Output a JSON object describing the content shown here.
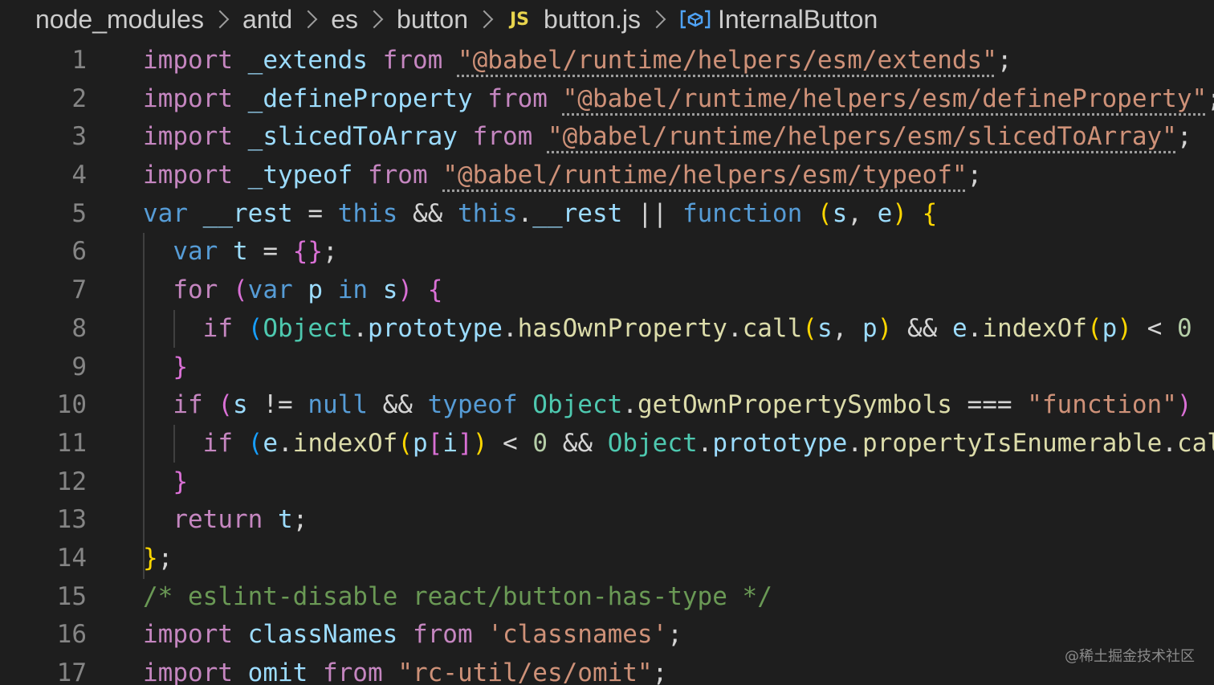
{
  "breadcrumb": {
    "items": [
      {
        "label": "node_modules"
      },
      {
        "label": "antd"
      },
      {
        "label": "es"
      },
      {
        "label": "button"
      },
      {
        "label": "button.js",
        "icon": "javascript-file-icon",
        "icon_text": "JS"
      },
      {
        "label": "InternalButton",
        "icon": "variable-symbol-icon"
      }
    ]
  },
  "colors": {
    "background": "#1e1e1e",
    "keyword_control": "#c586c0",
    "string": "#ce9178",
    "variable": "#9cdcfe",
    "storage_keyword": "#569cd6",
    "function": "#dcdcaa",
    "type": "#4ec9b0",
    "comment": "#6a9955",
    "bracket_gold": "#ffd700",
    "bracket_orchid": "#da70d6",
    "bracket_blue": "#179fff",
    "line_number": "#858585"
  },
  "code": {
    "lines": [
      {
        "n": "1",
        "tokens": [
          [
            "kw",
            "import"
          ],
          [
            "pu",
            " "
          ],
          [
            "vr",
            "_extends"
          ],
          [
            "pu",
            " "
          ],
          [
            "kw",
            "from"
          ],
          [
            "pu",
            " "
          ],
          [
            "st",
            "\"@babel/runtime/helpers/esm/extends\"",
            "squig"
          ],
          [
            "pu",
            ";"
          ]
        ]
      },
      {
        "n": "2",
        "tokens": [
          [
            "kw",
            "import"
          ],
          [
            "pu",
            " "
          ],
          [
            "vr",
            "_defineProperty"
          ],
          [
            "pu",
            " "
          ],
          [
            "kw",
            "from"
          ],
          [
            "pu",
            " "
          ],
          [
            "st",
            "\"@babel/runtime/helpers/esm/defineProperty\"",
            "squig"
          ],
          [
            "pu",
            ";"
          ]
        ]
      },
      {
        "n": "3",
        "tokens": [
          [
            "kw",
            "import"
          ],
          [
            "pu",
            " "
          ],
          [
            "vr",
            "_slicedToArray"
          ],
          [
            "pu",
            " "
          ],
          [
            "kw",
            "from"
          ],
          [
            "pu",
            " "
          ],
          [
            "st",
            "\"@babel/runtime/helpers/esm/slicedToArray\"",
            "squig"
          ],
          [
            "pu",
            ";"
          ]
        ]
      },
      {
        "n": "4",
        "tokens": [
          [
            "kw",
            "import"
          ],
          [
            "pu",
            " "
          ],
          [
            "vr",
            "_typeof"
          ],
          [
            "pu",
            " "
          ],
          [
            "kw",
            "from"
          ],
          [
            "pu",
            " "
          ],
          [
            "st",
            "\"@babel/runtime/helpers/esm/typeof\"",
            "squig"
          ],
          [
            "pu",
            ";"
          ]
        ]
      },
      {
        "n": "5",
        "tokens": [
          [
            "sk",
            "var"
          ],
          [
            "pu",
            " "
          ],
          [
            "vr",
            "__rest"
          ],
          [
            "pu",
            " = "
          ],
          [
            "sk",
            "this"
          ],
          [
            "pu",
            " && "
          ],
          [
            "sk",
            "this"
          ],
          [
            "pu",
            "."
          ],
          [
            "vr",
            "__rest"
          ],
          [
            "pu",
            " || "
          ],
          [
            "sk",
            "function"
          ],
          [
            "pu",
            " "
          ],
          [
            "b1",
            "("
          ],
          [
            "vr",
            "s"
          ],
          [
            "pu",
            ", "
          ],
          [
            "vr",
            "e"
          ],
          [
            "b1",
            ")"
          ],
          [
            "pu",
            " "
          ],
          [
            "b1",
            "{"
          ]
        ]
      },
      {
        "n": "6",
        "tokens": [
          [
            "pu",
            "  "
          ],
          [
            "sk",
            "var"
          ],
          [
            "pu",
            " "
          ],
          [
            "vr",
            "t"
          ],
          [
            "pu",
            " = "
          ],
          [
            "b2",
            "{}"
          ],
          [
            "pu",
            ";"
          ]
        ]
      },
      {
        "n": "7",
        "tokens": [
          [
            "pu",
            "  "
          ],
          [
            "kw",
            "for"
          ],
          [
            "pu",
            " "
          ],
          [
            "b2",
            "("
          ],
          [
            "sk",
            "var"
          ],
          [
            "pu",
            " "
          ],
          [
            "vr",
            "p"
          ],
          [
            "pu",
            " "
          ],
          [
            "sk",
            "in"
          ],
          [
            "pu",
            " "
          ],
          [
            "vr",
            "s"
          ],
          [
            "b2",
            ")"
          ],
          [
            "pu",
            " "
          ],
          [
            "b2",
            "{"
          ]
        ]
      },
      {
        "n": "8",
        "tokens": [
          [
            "pu",
            "    "
          ],
          [
            "kw",
            "if"
          ],
          [
            "pu",
            " "
          ],
          [
            "b3",
            "("
          ],
          [
            "ty",
            "Object"
          ],
          [
            "pu",
            "."
          ],
          [
            "vr",
            "prototype"
          ],
          [
            "pu",
            "."
          ],
          [
            "fn",
            "hasOwnProperty"
          ],
          [
            "pu",
            "."
          ],
          [
            "fn",
            "call"
          ],
          [
            "b1",
            "("
          ],
          [
            "vr",
            "s"
          ],
          [
            "pu",
            ", "
          ],
          [
            "vr",
            "p"
          ],
          [
            "b1",
            ")"
          ],
          [
            "pu",
            " && "
          ],
          [
            "vr",
            "e"
          ],
          [
            "pu",
            "."
          ],
          [
            "fn",
            "indexOf"
          ],
          [
            "b1",
            "("
          ],
          [
            "vr",
            "p"
          ],
          [
            "b1",
            ")"
          ],
          [
            "pu",
            " < "
          ],
          [
            "nu",
            "0"
          ]
        ]
      },
      {
        "n": "9",
        "tokens": [
          [
            "pu",
            "  "
          ],
          [
            "b2",
            "}"
          ]
        ]
      },
      {
        "n": "10",
        "tokens": [
          [
            "pu",
            "  "
          ],
          [
            "kw",
            "if"
          ],
          [
            "pu",
            " "
          ],
          [
            "b2",
            "("
          ],
          [
            "vr",
            "s"
          ],
          [
            "pu",
            " != "
          ],
          [
            "sk",
            "null"
          ],
          [
            "pu",
            " && "
          ],
          [
            "sk",
            "typeof"
          ],
          [
            "pu",
            " "
          ],
          [
            "ty",
            "Object"
          ],
          [
            "pu",
            "."
          ],
          [
            "fn",
            "getOwnPropertySymbols"
          ],
          [
            "pu",
            " === "
          ],
          [
            "st",
            "\"function\""
          ],
          [
            "b2",
            ")"
          ]
        ]
      },
      {
        "n": "11",
        "tokens": [
          [
            "pu",
            "    "
          ],
          [
            "kw",
            "if"
          ],
          [
            "pu",
            " "
          ],
          [
            "b3",
            "("
          ],
          [
            "vr",
            "e"
          ],
          [
            "pu",
            "."
          ],
          [
            "fn",
            "indexOf"
          ],
          [
            "b1",
            "("
          ],
          [
            "vr",
            "p"
          ],
          [
            "b2",
            "["
          ],
          [
            "vr",
            "i"
          ],
          [
            "b2",
            "]"
          ],
          [
            "b1",
            ")"
          ],
          [
            "pu",
            " < "
          ],
          [
            "nu",
            "0"
          ],
          [
            "pu",
            " && "
          ],
          [
            "ty",
            "Object"
          ],
          [
            "pu",
            "."
          ],
          [
            "vr",
            "prototype"
          ],
          [
            "pu",
            "."
          ],
          [
            "fn",
            "propertyIsEnumerable"
          ],
          [
            "pu",
            "."
          ],
          [
            "fn",
            "call"
          ]
        ]
      },
      {
        "n": "12",
        "tokens": [
          [
            "pu",
            "  "
          ],
          [
            "b2",
            "}"
          ]
        ]
      },
      {
        "n": "13",
        "tokens": [
          [
            "pu",
            "  "
          ],
          [
            "kw",
            "return"
          ],
          [
            "pu",
            " "
          ],
          [
            "vr",
            "t"
          ],
          [
            "pu",
            ";"
          ]
        ]
      },
      {
        "n": "14",
        "tokens": [
          [
            "b1",
            "}"
          ],
          [
            "pu",
            ";"
          ]
        ]
      },
      {
        "n": "15",
        "tokens": [
          [
            "cm",
            "/* eslint-disable react/button-has-type */"
          ]
        ]
      },
      {
        "n": "16",
        "tokens": [
          [
            "kw",
            "import"
          ],
          [
            "pu",
            " "
          ],
          [
            "vr",
            "classNames"
          ],
          [
            "pu",
            " "
          ],
          [
            "kw",
            "from"
          ],
          [
            "pu",
            " "
          ],
          [
            "st",
            "'classnames'"
          ],
          [
            "pu",
            ";"
          ]
        ]
      },
      {
        "n": "17",
        "tokens": [
          [
            "kw",
            "import"
          ],
          [
            "pu",
            " "
          ],
          [
            "vr",
            "omit"
          ],
          [
            "pu",
            " "
          ],
          [
            "kw",
            "from"
          ],
          [
            "pu",
            " "
          ],
          [
            "st",
            "\"rc-util/es/omit\""
          ],
          [
            "pu",
            ";"
          ]
        ]
      }
    ]
  },
  "watermark": "@稀土掘金技术社区"
}
